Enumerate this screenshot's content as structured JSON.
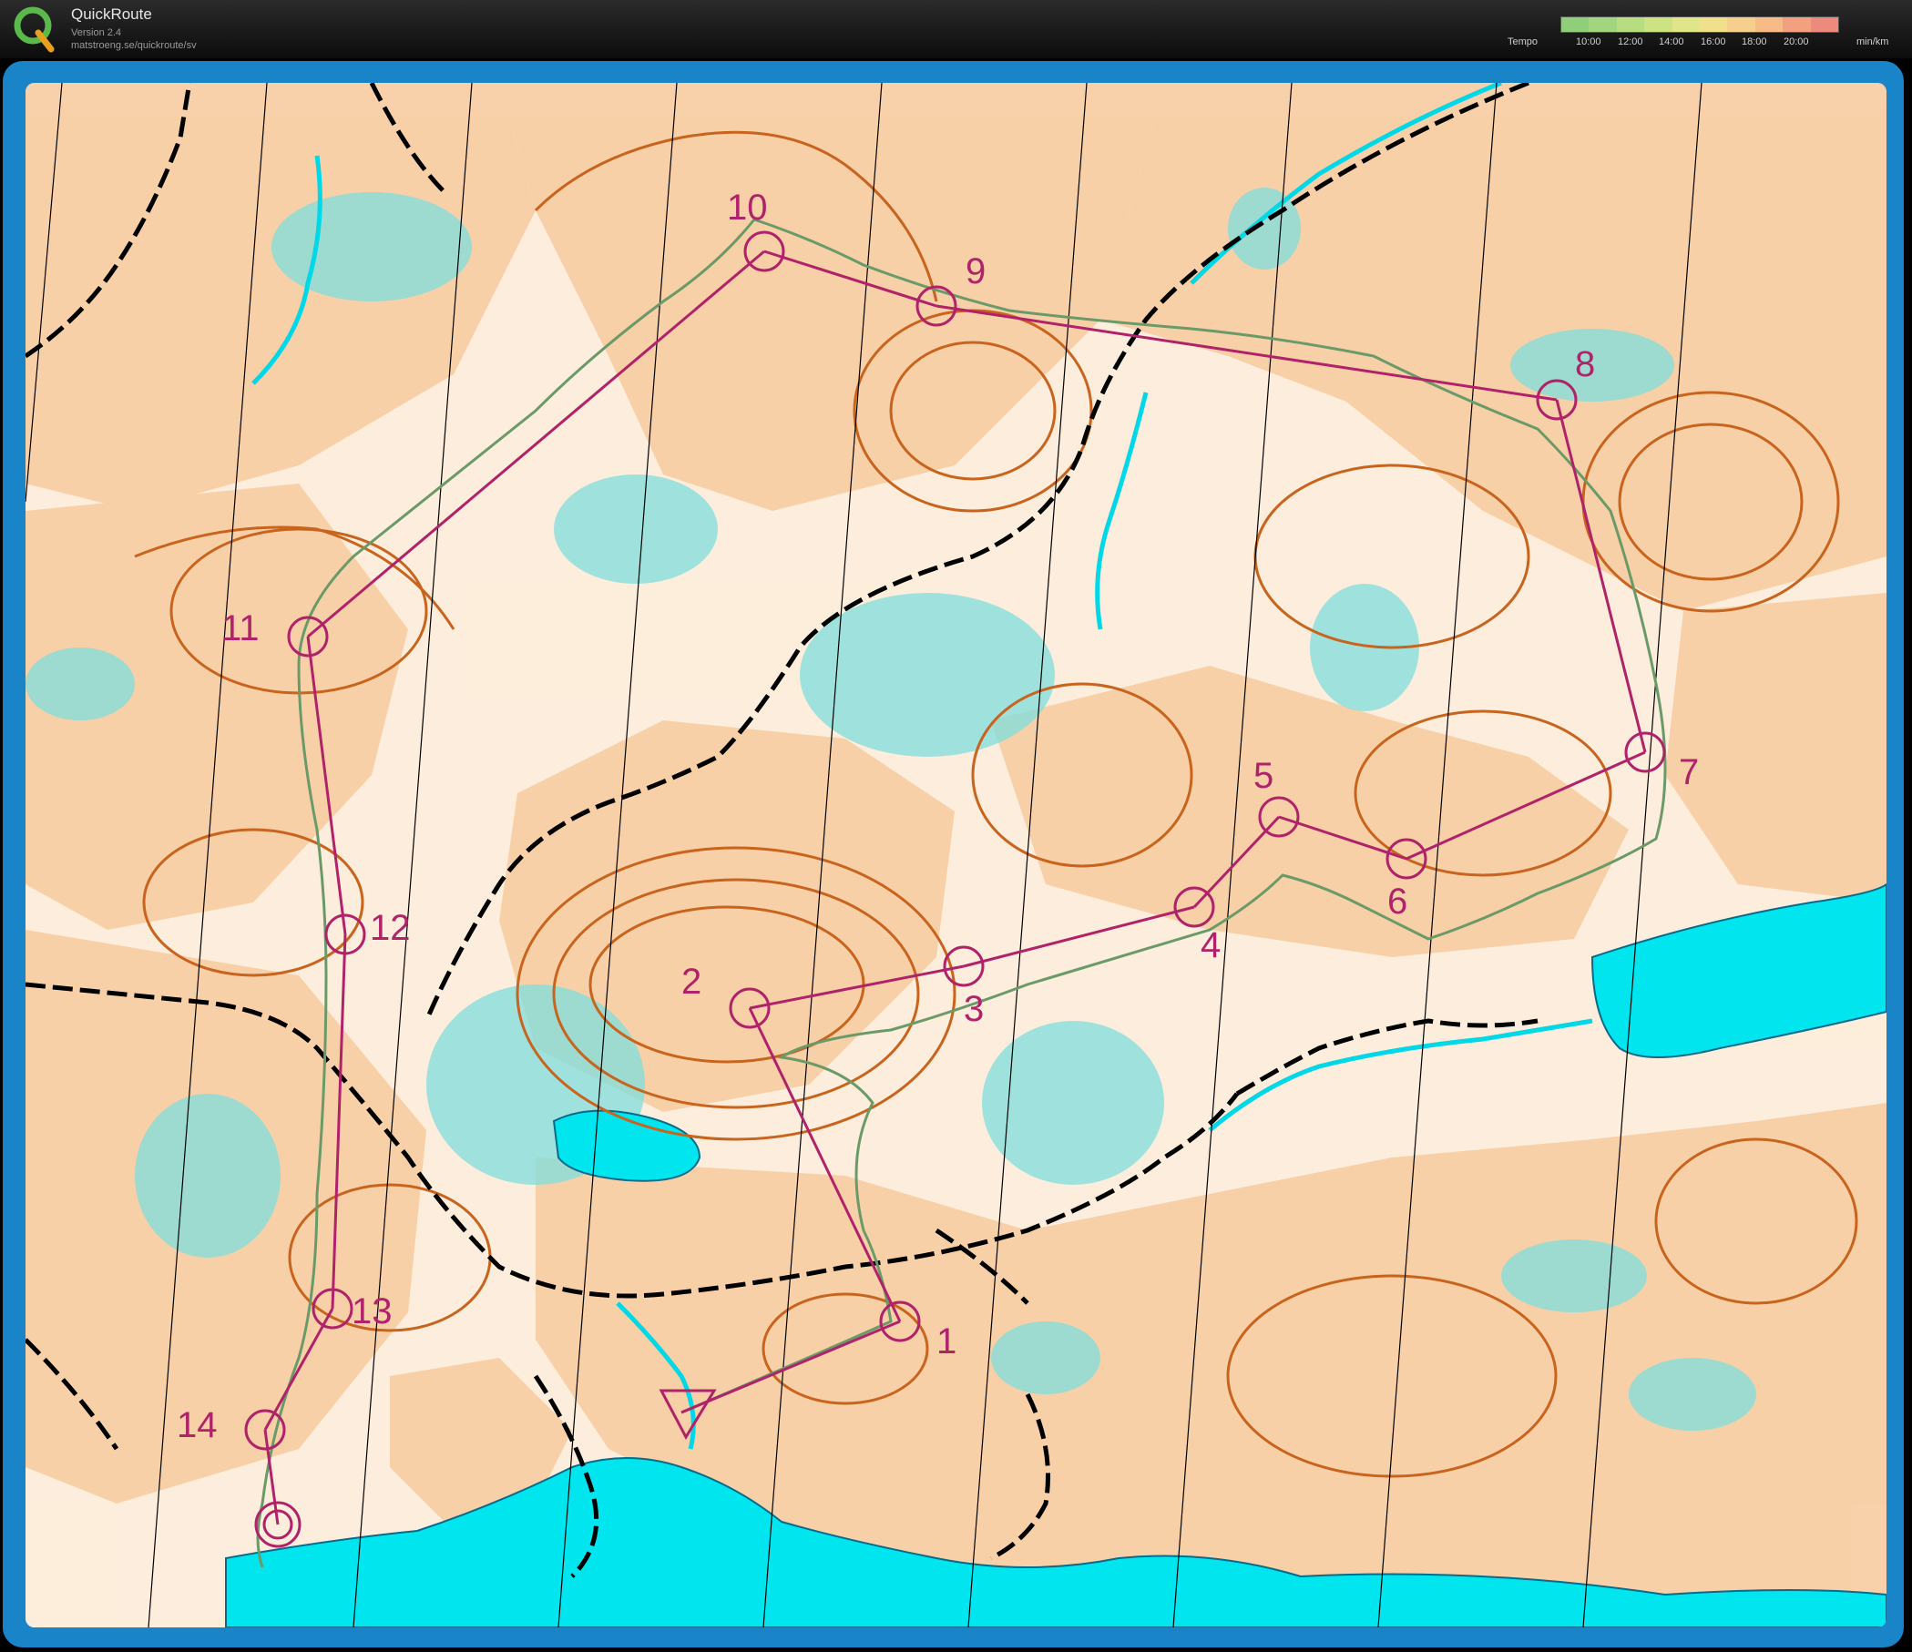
{
  "app": {
    "name": "QuickRoute",
    "version": "Version 2.4",
    "url": "matstroeng.se/quickroute/sv"
  },
  "tempo": {
    "label": "Tempo",
    "ticks": [
      "10:00",
      "12:00",
      "14:00",
      "16:00",
      "18:00",
      "20:00"
    ],
    "unit": "min/km",
    "colors": [
      "#8fcf7a",
      "#a3d57e",
      "#b8dc80",
      "#cde283",
      "#e0e589",
      "#efe08c",
      "#f6cf8c",
      "#f7bb88",
      "#f2a07f",
      "#ec8a7e"
    ]
  },
  "colors": {
    "frame": "#1a84c8",
    "course": "#b0226a",
    "route": "#6a9a68",
    "water": "#00e5ee",
    "marsh": "#3cc8c8",
    "open_land": "#f7c89a",
    "contour": "#c8641e",
    "path": "#000000"
  },
  "course": {
    "start": {
      "label": ""
    },
    "controls": [
      {
        "number": "1"
      },
      {
        "number": "2"
      },
      {
        "number": "3"
      },
      {
        "number": "4"
      },
      {
        "number": "5"
      },
      {
        "number": "6"
      },
      {
        "number": "7"
      },
      {
        "number": "8"
      },
      {
        "number": "9"
      },
      {
        "number": "10"
      },
      {
        "number": "11"
      },
      {
        "number": "12"
      },
      {
        "number": "13"
      },
      {
        "number": "14"
      }
    ],
    "finish": {
      "label": ""
    }
  }
}
